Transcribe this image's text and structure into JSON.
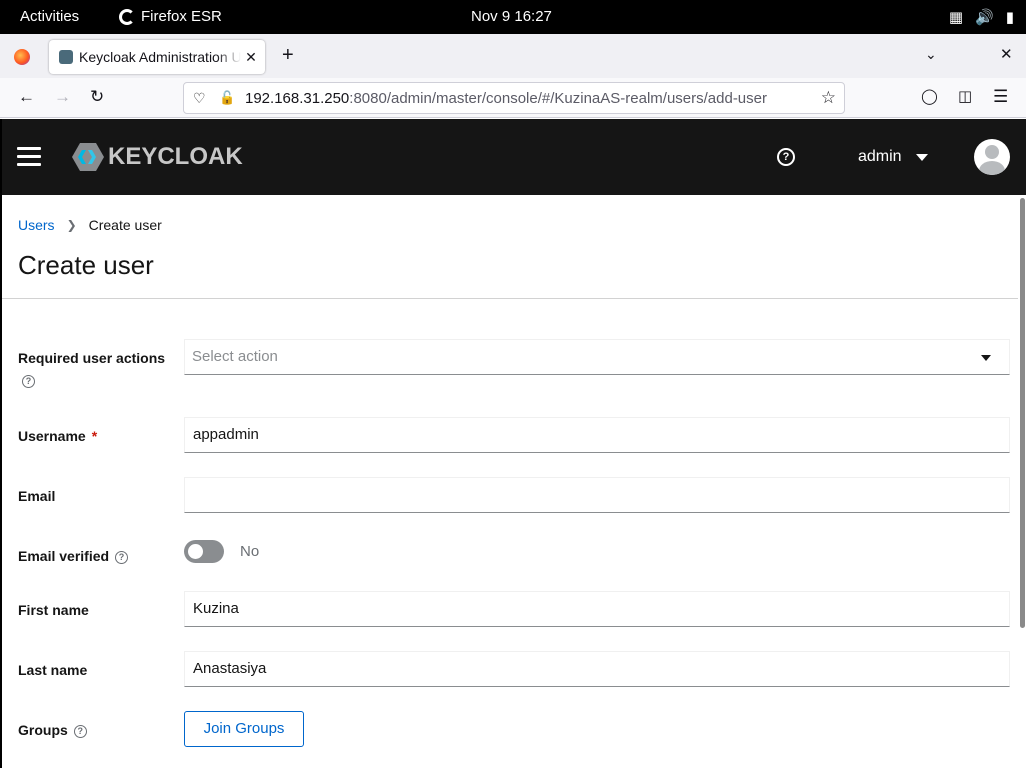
{
  "system_bar": {
    "activities": "Activities",
    "app_name": "Firefox ESR",
    "clock": "Nov 9  16:27",
    "tray_icons": [
      "network-icon",
      "volume-icon",
      "power-icon",
      "battery-icon"
    ]
  },
  "browser": {
    "tab_title": "Keycloak Administration UI",
    "url_host": "192.168.31.250",
    "url_path": ":8080/admin/master/console/#/KuzinaAS-realm/users/add-user"
  },
  "keycloak_header": {
    "logo_text": "KEYCLOAK",
    "username": "admin"
  },
  "breadcrumb": {
    "parent": "Users",
    "current": "Create user"
  },
  "page": {
    "title": "Create user"
  },
  "form": {
    "required_actions": {
      "label": "Required user actions",
      "placeholder": "Select action"
    },
    "username": {
      "label": "Username",
      "required_mark": "*",
      "value": "appadmin"
    },
    "email": {
      "label": "Email",
      "value": ""
    },
    "email_verified": {
      "label": "Email verified",
      "state_text": "No",
      "enabled": false
    },
    "first_name": {
      "label": "First name",
      "value": "Kuzina"
    },
    "last_name": {
      "label": "Last name",
      "value": "Anastasiya"
    },
    "groups": {
      "label": "Groups",
      "button": "Join Groups"
    }
  },
  "colors": {
    "header_bg": "#151515",
    "link": "#0066cc",
    "required": "#c9190b",
    "toggle_off": "#8a8d90"
  }
}
